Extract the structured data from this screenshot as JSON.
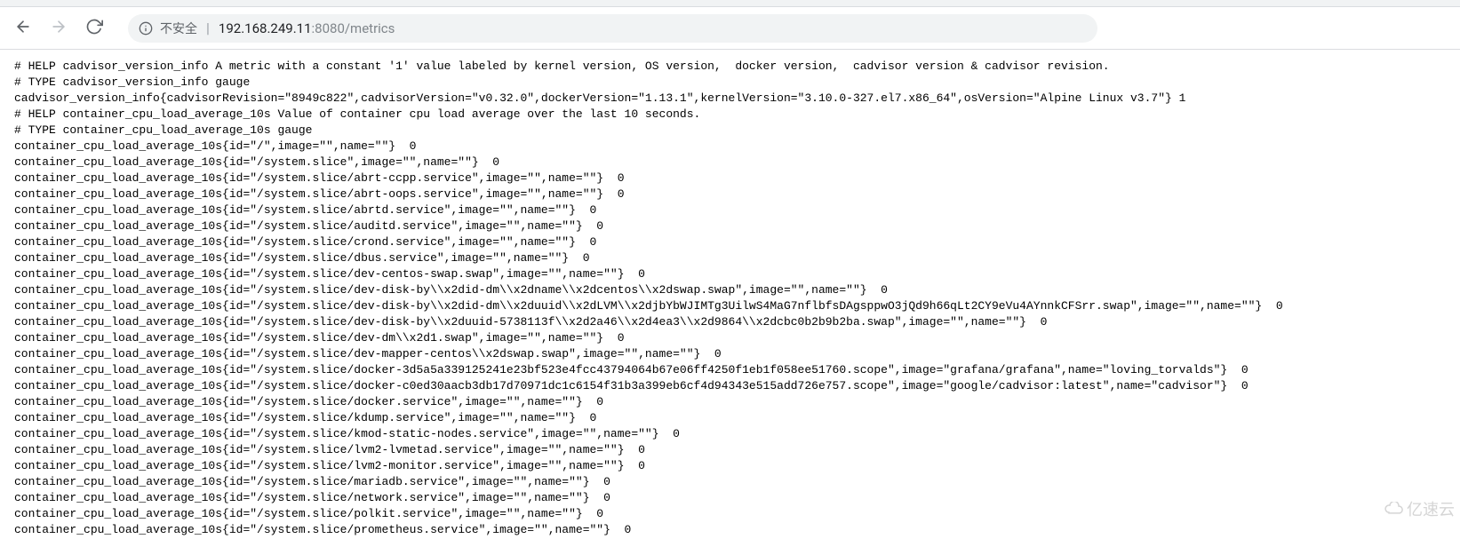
{
  "browser": {
    "security_label": "不安全",
    "url_host": "192.168.249.11",
    "url_port_path": ":8080/metrics"
  },
  "watermark": {
    "text": "亿速云"
  },
  "metrics": {
    "lines": [
      "# HELP cadvisor_version_info A metric with a constant '1' value labeled by kernel version, OS version,  docker version,  cadvisor version & cadvisor revision.",
      "# TYPE cadvisor_version_info gauge",
      "cadvisor_version_info{cadvisorRevision=\"8949c822\",cadvisorVersion=\"v0.32.0\",dockerVersion=\"1.13.1\",kernelVersion=\"3.10.0-327.el7.x86_64\",osVersion=\"Alpine Linux v3.7\"} 1",
      "# HELP container_cpu_load_average_10s Value of container cpu load average over the last 10 seconds.",
      "# TYPE container_cpu_load_average_10s gauge",
      "container_cpu_load_average_10s{id=\"/\",image=\"\",name=\"\"}  0",
      "container_cpu_load_average_10s{id=\"/system.slice\",image=\"\",name=\"\"}  0",
      "container_cpu_load_average_10s{id=\"/system.slice/abrt-ccpp.service\",image=\"\",name=\"\"}  0",
      "container_cpu_load_average_10s{id=\"/system.slice/abrt-oops.service\",image=\"\",name=\"\"}  0",
      "container_cpu_load_average_10s{id=\"/system.slice/abrtd.service\",image=\"\",name=\"\"}  0",
      "container_cpu_load_average_10s{id=\"/system.slice/auditd.service\",image=\"\",name=\"\"}  0",
      "container_cpu_load_average_10s{id=\"/system.slice/crond.service\",image=\"\",name=\"\"}  0",
      "container_cpu_load_average_10s{id=\"/system.slice/dbus.service\",image=\"\",name=\"\"}  0",
      "container_cpu_load_average_10s{id=\"/system.slice/dev-centos-swap.swap\",image=\"\",name=\"\"}  0",
      "container_cpu_load_average_10s{id=\"/system.slice/dev-disk-by\\\\x2did-dm\\\\x2dname\\\\x2dcentos\\\\x2dswap.swap\",image=\"\",name=\"\"}  0",
      "container_cpu_load_average_10s{id=\"/system.slice/dev-disk-by\\\\x2did-dm\\\\x2duuid\\\\x2dLVM\\\\x2djbYbWJIMTg3UilwS4MaG7nflbfsDAgsppwO3jQd9h66qLt2CY9eVu4AYnnkCFSrr.swap\",image=\"\",name=\"\"}  0",
      "container_cpu_load_average_10s{id=\"/system.slice/dev-disk-by\\\\x2duuid-5738113f\\\\x2d2a46\\\\x2d4ea3\\\\x2d9864\\\\x2dcbc0b2b9b2ba.swap\",image=\"\",name=\"\"}  0",
      "container_cpu_load_average_10s{id=\"/system.slice/dev-dm\\\\x2d1.swap\",image=\"\",name=\"\"}  0",
      "container_cpu_load_average_10s{id=\"/system.slice/dev-mapper-centos\\\\x2dswap.swap\",image=\"\",name=\"\"}  0",
      "container_cpu_load_average_10s{id=\"/system.slice/docker-3d5a5a339125241e23bf523e4fcc43794064b67e06ff4250f1eb1f058ee51760.scope\",image=\"grafana/grafana\",name=\"loving_torvalds\"}  0",
      "container_cpu_load_average_10s{id=\"/system.slice/docker-c0ed30aacb3db17d70971dc1c6154f31b3a399eb6cf4d94343e515add726e757.scope\",image=\"google/cadvisor:latest\",name=\"cadvisor\"}  0",
      "container_cpu_load_average_10s{id=\"/system.slice/docker.service\",image=\"\",name=\"\"}  0",
      "container_cpu_load_average_10s{id=\"/system.slice/kdump.service\",image=\"\",name=\"\"}  0",
      "container_cpu_load_average_10s{id=\"/system.slice/kmod-static-nodes.service\",image=\"\",name=\"\"}  0",
      "container_cpu_load_average_10s{id=\"/system.slice/lvm2-lvmetad.service\",image=\"\",name=\"\"}  0",
      "container_cpu_load_average_10s{id=\"/system.slice/lvm2-monitor.service\",image=\"\",name=\"\"}  0",
      "container_cpu_load_average_10s{id=\"/system.slice/mariadb.service\",image=\"\",name=\"\"}  0",
      "container_cpu_load_average_10s{id=\"/system.slice/network.service\",image=\"\",name=\"\"}  0",
      "container_cpu_load_average_10s{id=\"/system.slice/polkit.service\",image=\"\",name=\"\"}  0",
      "container_cpu_load_average_10s{id=\"/system.slice/prometheus.service\",image=\"\",name=\"\"}  0"
    ]
  }
}
